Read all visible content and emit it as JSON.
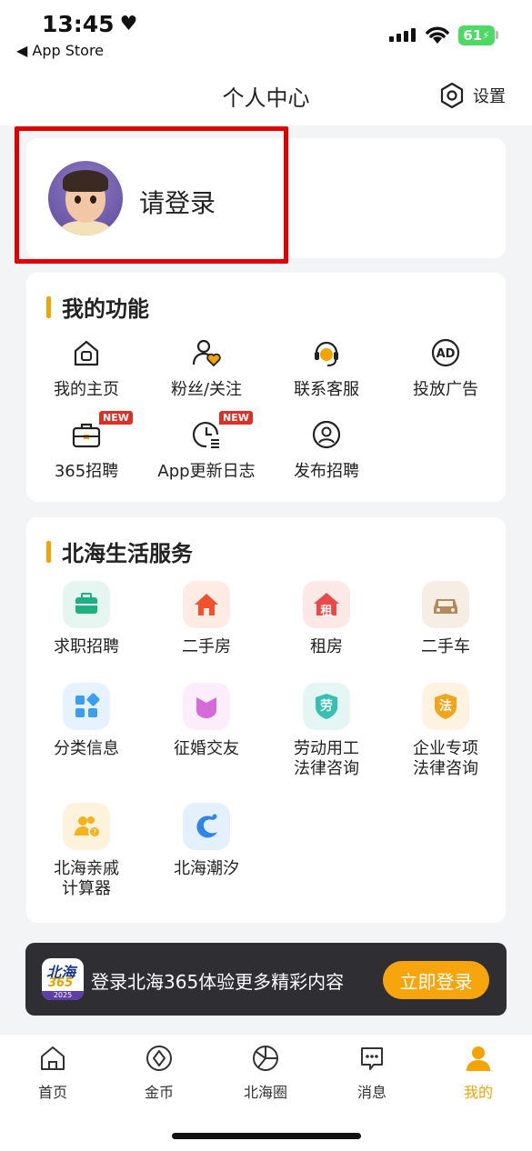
{
  "status_bar": {
    "time": "13:45",
    "back_label": "◀ App Store",
    "battery": "61"
  },
  "header": {
    "title": "个人中心",
    "settings_label": "设置"
  },
  "login": {
    "text": "请登录"
  },
  "functions": {
    "title": "我的功能",
    "new_badge": "NEW",
    "items": [
      {
        "label": "我的主页",
        "icon": "home-icon"
      },
      {
        "label": "粉丝/关注",
        "icon": "user-heart-icon"
      },
      {
        "label": "联系客服",
        "icon": "customer-service-icon"
      },
      {
        "label": "投放广告",
        "icon": "ad-icon"
      },
      {
        "label": "365招聘",
        "icon": "briefcase-icon",
        "badge": "NEW"
      },
      {
        "label": "App更新日志",
        "icon": "update-log-icon",
        "badge": "NEW"
      },
      {
        "label": "发布招聘",
        "icon": "publish-job-icon"
      }
    ]
  },
  "services": {
    "title": "北海生活服务",
    "items": [
      {
        "label": "求职招聘",
        "icon": "job-bag-icon",
        "color": "#1fb082",
        "bg": "#e4f6ef"
      },
      {
        "label": "二手房",
        "icon": "house-icon",
        "color": "#f0532b",
        "bg": "#fdebe4"
      },
      {
        "label": "租房",
        "icon": "rent-icon",
        "glyph": "租",
        "color": "#e84a4a",
        "bg": "#fde8e8"
      },
      {
        "label": "二手车",
        "icon": "car-icon",
        "color": "#b58a5a",
        "bg": "#f6eee5"
      },
      {
        "label": "分类信息",
        "icon": "category-icon",
        "color": "#3b9ef5",
        "bg": "#e6f2fd"
      },
      {
        "label": "征婚交友",
        "icon": "dating-icon",
        "color": "#d56ad8",
        "bg": "#fbeefa"
      },
      {
        "label_line1": "劳动用工",
        "label_line2": "法律咨询",
        "icon": "labor-law-icon",
        "glyph": "劳",
        "color": "#35c1b0",
        "bg": "#e3f6f3"
      },
      {
        "label_line1": "企业专项",
        "label_line2": "法律咨询",
        "icon": "enterprise-law-icon",
        "glyph": "法",
        "color": "#f1a51c",
        "bg": "#fdf3e0"
      },
      {
        "label_line1": "北海亲戚",
        "label_line2": "计算器",
        "icon": "relative-calculator-icon",
        "color": "#f4b21d",
        "bg": "#fdf3dc"
      },
      {
        "label": "北海潮汐",
        "icon": "tide-icon",
        "color": "#2f86e8",
        "bg": "#e4f0fc"
      }
    ]
  },
  "toast": {
    "logo_line1": "北海",
    "logo_line2": "365",
    "logo_line3": "2025",
    "text": "登录北海365体验更多精彩内容",
    "button": "立即登录"
  },
  "tabbar": {
    "items": [
      {
        "label": "首页",
        "icon": "home-tab-icon"
      },
      {
        "label": "金币",
        "icon": "coin-icon"
      },
      {
        "label": "北海圈",
        "icon": "circle-icon"
      },
      {
        "label": "消息",
        "icon": "message-icon"
      },
      {
        "label": "我的",
        "icon": "profile-icon",
        "active": true
      }
    ],
    "active_color": "#f4a300"
  }
}
